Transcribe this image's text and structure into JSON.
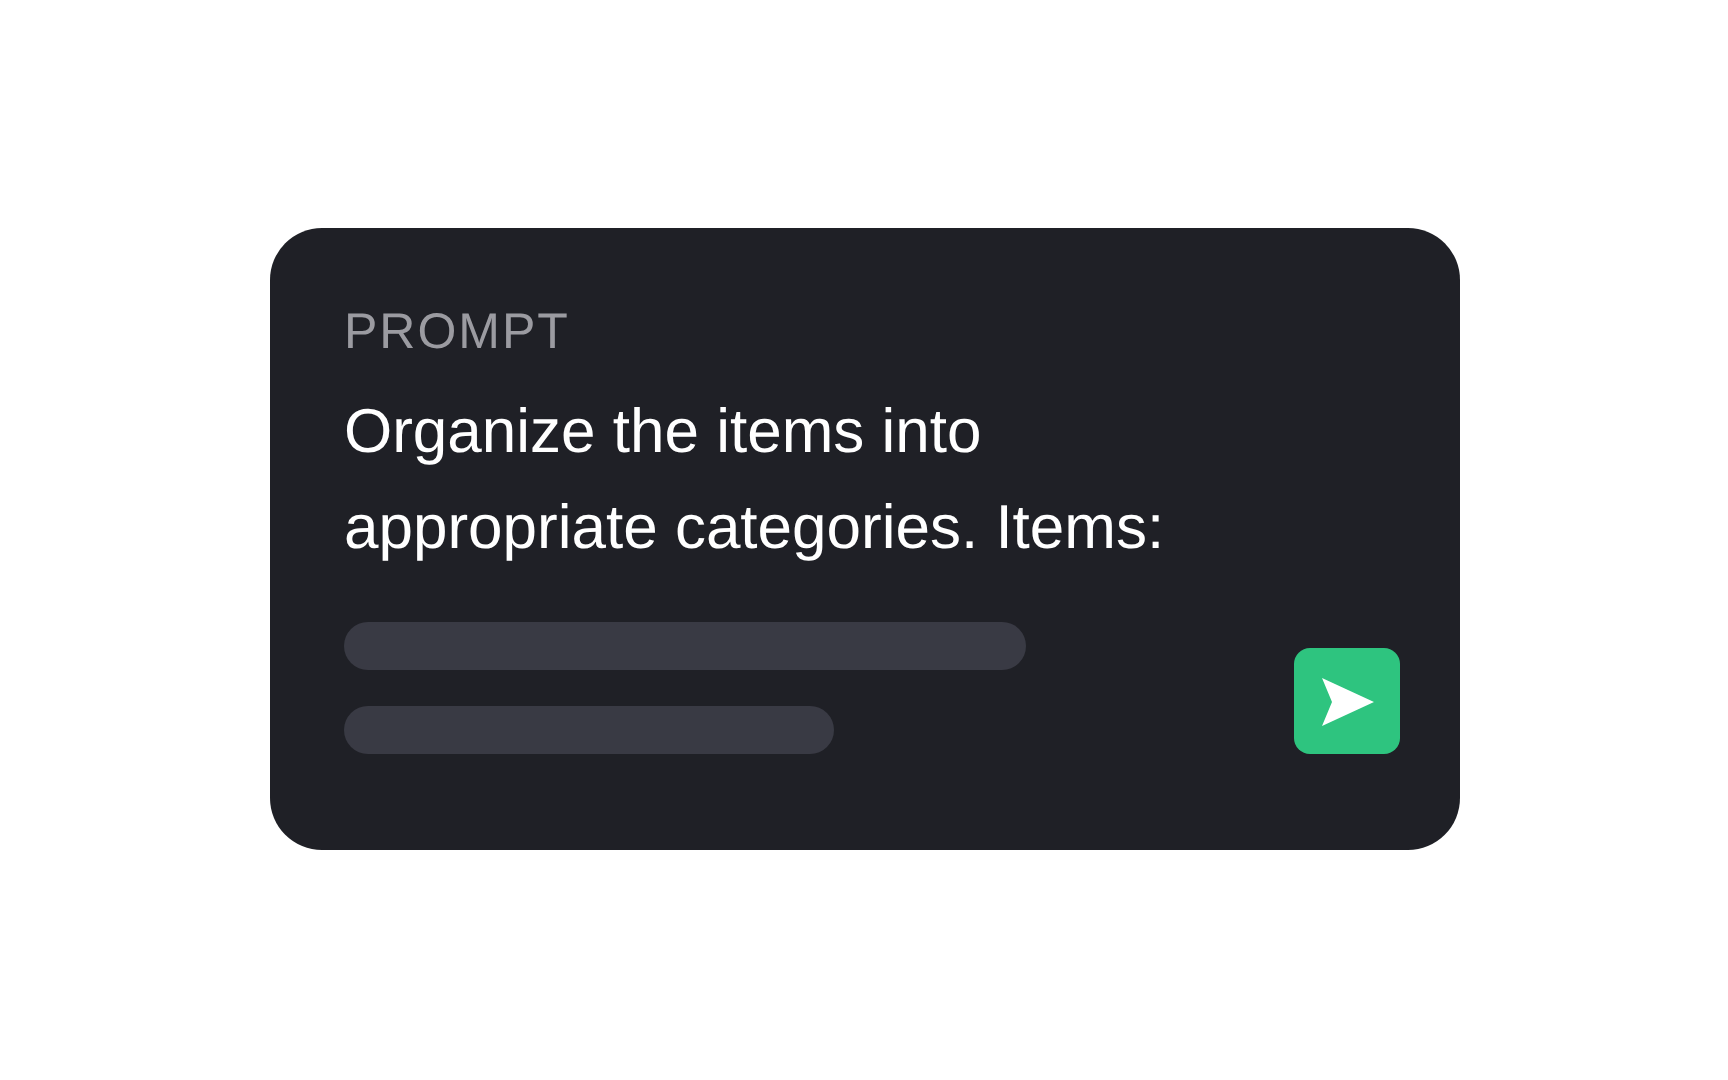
{
  "card": {
    "label": "PROMPT",
    "text": "Organize the items into appropriate categories. Items:"
  }
}
